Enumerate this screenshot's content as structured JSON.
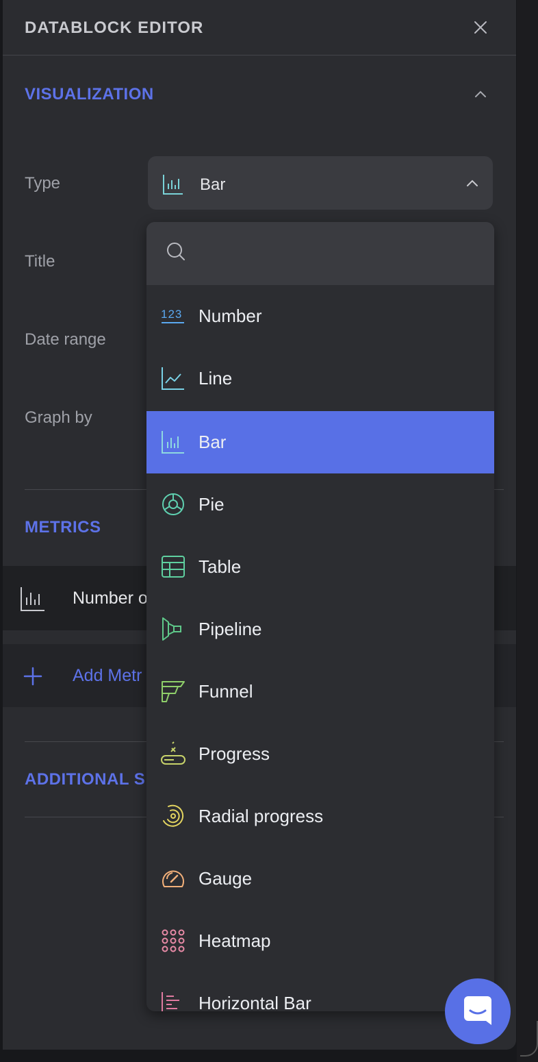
{
  "header": {
    "title": "DATABLOCK EDITOR"
  },
  "visualization": {
    "section_title": "VISUALIZATION",
    "labels": {
      "type": "Type",
      "title": "Title",
      "date_range": "Date range",
      "graph_by": "Graph by"
    },
    "type_value": "Bar"
  },
  "metrics": {
    "section_title": "METRICS",
    "items": [
      {
        "label": "Number o"
      }
    ],
    "add_label": "Add Metr"
  },
  "additional": {
    "section_title": "ADDITIONAL S"
  },
  "dropdown": {
    "search_placeholder": "",
    "selected": "Bar",
    "options": [
      {
        "label": "Number",
        "icon": "number-123-icon"
      },
      {
        "label": "Line",
        "icon": "line-chart-icon"
      },
      {
        "label": "Bar",
        "icon": "bar-chart-icon"
      },
      {
        "label": "Pie",
        "icon": "pie-chart-icon"
      },
      {
        "label": "Table",
        "icon": "table-icon"
      },
      {
        "label": "Pipeline",
        "icon": "pipeline-icon"
      },
      {
        "label": "Funnel",
        "icon": "funnel-icon"
      },
      {
        "label": "Progress",
        "icon": "progress-icon"
      },
      {
        "label": "Radial progress",
        "icon": "radial-progress-icon"
      },
      {
        "label": "Gauge",
        "icon": "gauge-icon"
      },
      {
        "label": "Heatmap",
        "icon": "heatmap-icon"
      },
      {
        "label": "Horizontal Bar",
        "icon": "horizontal-bar-icon"
      }
    ]
  },
  "colors": {
    "accent": "#5870e6",
    "panel_bg": "#2b2c30",
    "text_primary": "#e6e7ea",
    "text_muted": "#9fa1a8"
  }
}
